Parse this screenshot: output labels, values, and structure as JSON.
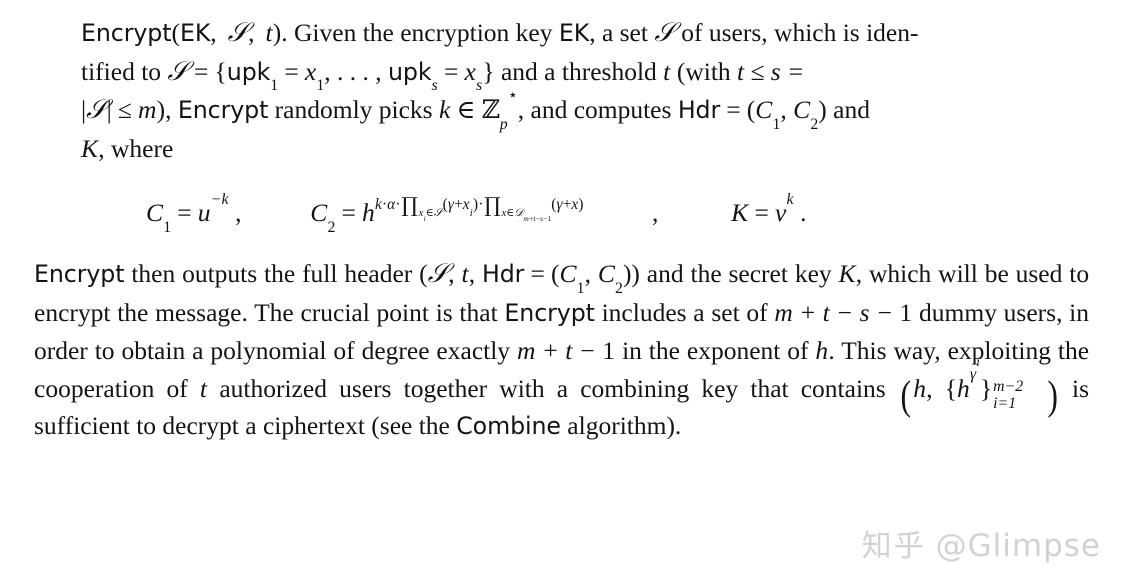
{
  "document": {
    "type": "academic-paper-excerpt",
    "topic": "Broadcast encryption Encrypt algorithm description",
    "background_color": "#ffffff",
    "text_color": "#141414"
  },
  "paragraph1": {
    "algorithm_name": "Encrypt",
    "signature_args": "(EK, S, t).",
    "line1_a": "Given the encryption key",
    "line1_b": "EK",
    "line1_c": ", a set",
    "line1_d": "S",
    "line1_e": "of users, which is iden-",
    "line2_a": "tified to",
    "line2_b": "S",
    "line2_c": "=",
    "line2_d": "{upk",
    "line2_sub1": "1",
    "line2_e": "=",
    "line2_f": "x",
    "line2_sub2": "1",
    "line2_g": ", . . . , upk",
    "line2_sub3": "s",
    "line2_h": "=",
    "line2_i": "x",
    "line2_sub4": "s",
    "line2_j": "} and a threshold",
    "line2_k": "t",
    "line2_l": "(with",
    "line2_m": "t ≤ s =",
    "line3_a": "|S| ≤ m),",
    "line3_b": "Encrypt",
    "line3_c": "randomly picks",
    "line3_d": "k ∈",
    "line3_e": "Z",
    "line3_sub": "p",
    "line3_sup": "⋆",
    "line3_f": ", and computes",
    "line3_g": "Hdr",
    "line3_h": "=",
    "line3_i": "(C",
    "line3_sub2": "1",
    "line3_j": ", C",
    "line3_sub3": "2",
    "line3_k": ") and",
    "line4_a": "K",
    "line4_b": ", where"
  },
  "equation": {
    "c1_lhs": "C",
    "c1_lhs_sub": "1",
    "c1_eq": "=",
    "c1_base": "u",
    "c1_exp": "−k",
    "c1_comma": ",",
    "c2_lhs": "C",
    "c2_lhs_sub": "2",
    "c2_eq": "=",
    "c2_base": "h",
    "c2_exp_k": "k",
    "c2_exp_dot1": "·",
    "c2_exp_alpha": "α",
    "c2_exp_dot2": "·",
    "c2_prod1_sym": "∏",
    "c2_prod1_sub_x": "x",
    "c2_prod1_sub_i": "i",
    "c2_prod1_sub_in": "∈",
    "c2_prod1_sub_S": "S",
    "c2_prod1_body": "(γ+x",
    "c2_prod1_body_sub": "i",
    "c2_prod1_body_end": ")",
    "c2_exp_dot3": "·",
    "c2_prod2_sym": "∏",
    "c2_prod2_sub_x": "x",
    "c2_prod2_sub_in": "∈",
    "c2_prod2_sub_D": "D",
    "c2_prod2_sub_idx": "m+t−s−1",
    "c2_prod2_body": "(γ+x)",
    "c2_comma": ",",
    "k_lhs": "K",
    "k_eq": "=",
    "k_base": "v",
    "k_exp": "k",
    "k_period": "."
  },
  "paragraph2": {
    "s1_a": "Encrypt",
    "s1_b": "then outputs the full header",
    "s1_c": "(S, t, Hdr",
    "s1_d": "=",
    "s1_e": "(C",
    "s1_sub1": "1",
    "s1_f": ", C",
    "s1_sub2": "2",
    "s1_g": ")) and the secret",
    "s2_a": "key",
    "s2_b": "K",
    "s2_c": ", which will be used to encrypt the message. The crucial point is that",
    "s3_a": "Encrypt",
    "s3_b": "includes a set of",
    "s3_c": "m + t − s − 1",
    "s3_d": "dummy users, in order to obtain",
    "s4_a": "a polynomial of degree exactly",
    "s4_b": "m + t − 1",
    "s4_c": "in the exponent of",
    "s4_d": "h",
    "s4_e": ". This way,",
    "s5_a": "exploiting the cooperation of",
    "s5_b": "t",
    "s5_c": "authorized users together with a combining",
    "s6_a": "key that contains",
    "s6_paren_open": "(",
    "s6_h": "h",
    "s6_comma": ",",
    "s6_brace_open": "{",
    "s6_hg": "h",
    "s6_gamma": "γ",
    "s6_gamma_sup": "i",
    "s6_brace_close": "}",
    "s6_sub": "i=1",
    "s6_sup": "m−2",
    "s6_paren_close": ")",
    "s6_b": "is sufficient to decrypt a ciphertext (see the",
    "s7_a": "Combine",
    "s7_b": "algorithm)."
  },
  "watermark": {
    "cjk": "知乎",
    "handle": "@Glimpse",
    "color": "#d2d2d2"
  }
}
